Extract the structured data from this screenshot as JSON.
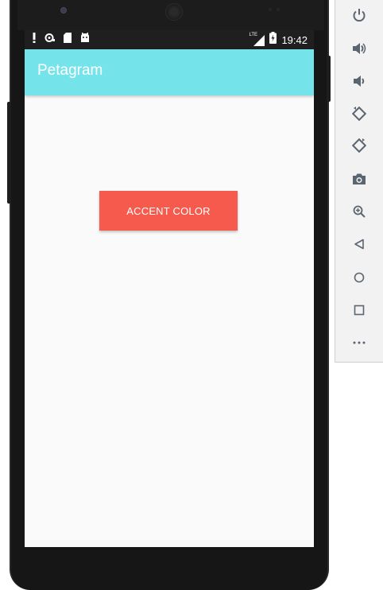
{
  "app": {
    "title": "Petagram"
  },
  "status_bar": {
    "time": "19:42",
    "network_label": "LTE"
  },
  "main": {
    "accent_button_label": "ACCENT COLOR"
  },
  "emulator_toolbar": {
    "items": [
      {
        "name": "power-icon"
      },
      {
        "name": "volume-up-icon"
      },
      {
        "name": "volume-down-icon"
      },
      {
        "name": "rotate-left-icon"
      },
      {
        "name": "rotate-right-icon"
      },
      {
        "name": "camera-icon"
      },
      {
        "name": "zoom-in-icon"
      },
      {
        "name": "back-icon"
      },
      {
        "name": "home-icon"
      },
      {
        "name": "overview-icon"
      },
      {
        "name": "more-icon"
      }
    ]
  },
  "colors": {
    "app_bar": "#74e3ea",
    "accent": "#f65a4d",
    "status_bar": "#1f1f1f",
    "screen_background": "#fafafa"
  }
}
